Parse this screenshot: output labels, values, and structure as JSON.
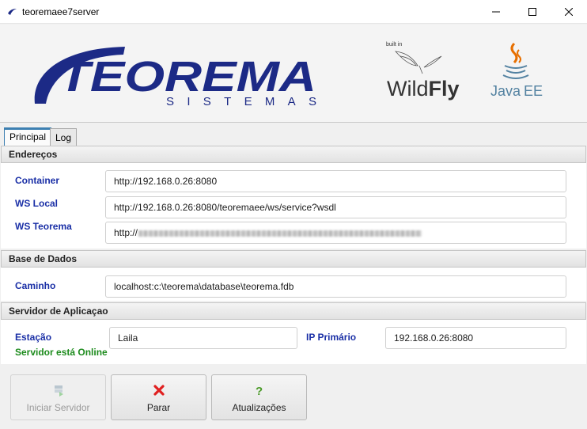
{
  "window": {
    "title": "teoremaee7server",
    "minimize_icon": "minimize-icon",
    "maximize_icon": "maximize-icon",
    "close_icon": "close-icon"
  },
  "banner": {
    "brand": "TEOREMA",
    "brand_sub": "SISTEMAS",
    "wildfly_builtin": "built in",
    "wildfly_wild": "Wild",
    "wildfly_fly": "Fly",
    "javaee_java": "Java",
    "javaee_ee": "EE",
    "accent_color": "#1c2a86"
  },
  "tabs": [
    {
      "label": "Principal",
      "active": true
    },
    {
      "label": "Log",
      "active": false
    }
  ],
  "enderecos": {
    "title": "Endereços",
    "container_label": "Container",
    "container_value": "http://192.168.0.26:8080",
    "wslocal_label": "WS Local",
    "wslocal_value": "http://192.168.0.26:8080/teoremaee/ws/service?wsdl",
    "wsteorema_label": "WS Teorema",
    "wsteorema_value": "http://"
  },
  "base_dados": {
    "title": "Base de Dados",
    "caminho_label": "Caminho",
    "caminho_value": "localhost:c:\\teorema\\database\\teorema.fdb"
  },
  "servidor": {
    "title": "Servidor de Aplicaçao",
    "estacao_label": "Estação",
    "estacao_value": "Laila",
    "status_text": "Servidor está Online",
    "ip_label": "IP Primário",
    "ip_value": "192.168.0.26:8080",
    "status_color": "#1c8b1c"
  },
  "buttons": {
    "iniciar_label": "Iniciar Servidor",
    "iniciar_icon": "server-start-icon",
    "parar_label": "Parar",
    "parar_icon": "red-x-icon",
    "atualizacoes_label": "Atualizações",
    "atualizacoes_icon": "green-question-icon"
  }
}
